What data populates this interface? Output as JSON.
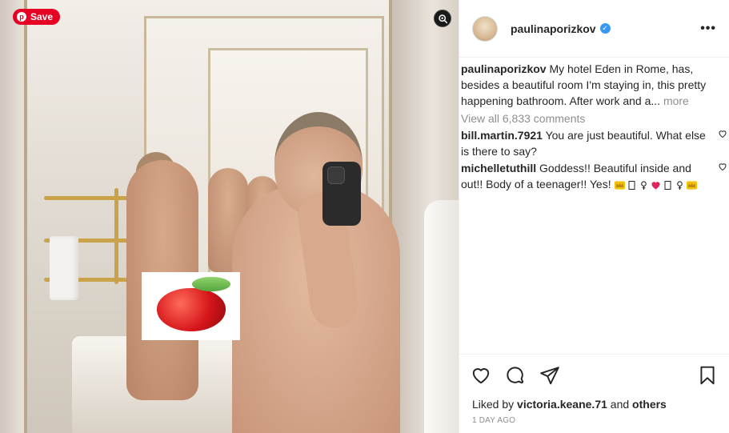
{
  "photo": {
    "save_label": "Save",
    "pin_glyph": "p"
  },
  "header": {
    "username": "paulinaporizkov",
    "verified_glyph": "✓",
    "more_glyph": "•••"
  },
  "caption": {
    "username": "paulinaporizkov",
    "text": " My hotel Eden in Rome, has, besides a beautiful room I'm staying in, this pretty happening bathroom. After work and a... ",
    "more_label": "more"
  },
  "view_all_comments": "View all 6,833 comments",
  "comments": [
    {
      "username": "bill.martin.7921",
      "text": " You are just beautiful. What else is there to say?"
    },
    {
      "username": "michelletuthill",
      "text": " Goddess!! Beautiful inside and out!! Body of a teenager!! Yes!"
    }
  ],
  "likes": {
    "prefix": "Liked by ",
    "user": "victoria.keane.71",
    "middle": " and ",
    "others": "others"
  },
  "time_ago": "1 DAY AGO",
  "icons": {
    "like": "heart-icon",
    "comment": "comment-icon",
    "share": "share-icon",
    "save": "bookmark-icon",
    "visual_search": "lens-icon"
  },
  "colors": {
    "pinterest_red": "#e60023",
    "verified_blue": "#3897f0",
    "muted": "#8e8e8e"
  }
}
